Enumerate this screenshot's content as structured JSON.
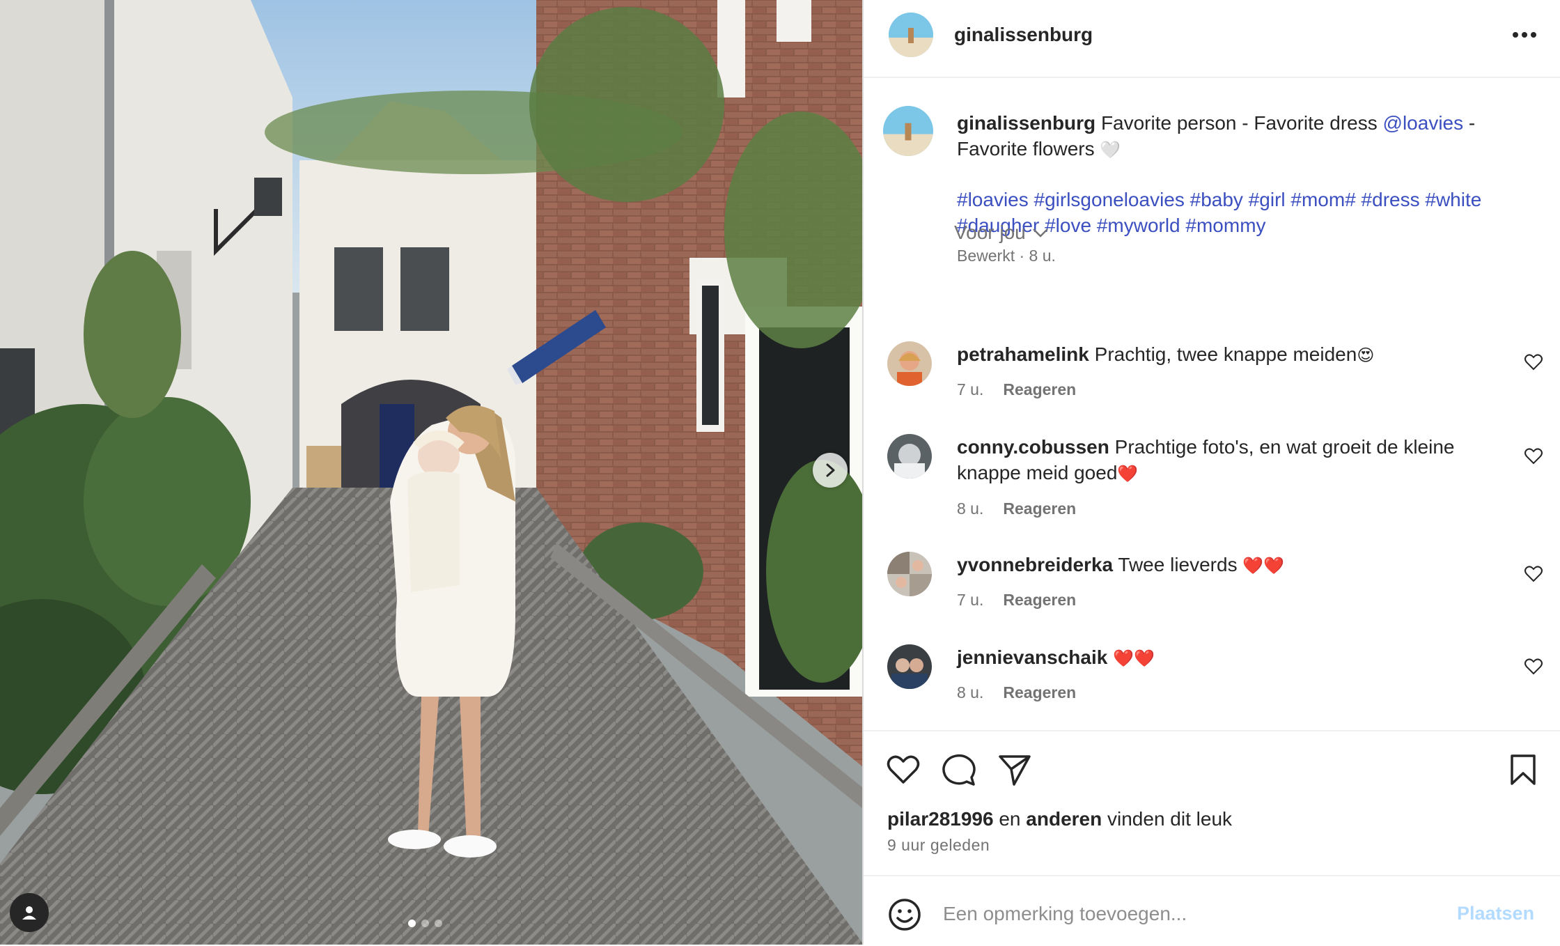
{
  "post": {
    "username": "ginalissenburg",
    "caption_text": "Favorite person - Favorite dress",
    "caption_mention": "@loavies",
    "caption_rest": "- Favorite flowers",
    "caption_emoji": "🤍",
    "hashtags_line1": "#loavies #girlsgoneloavies #baby #girl #mom# #dress #white",
    "hashtags_line2": "#daugher #love #myworld #mommy",
    "meta": "Bewerkt · 8 u."
  },
  "sort_label": "Voor jou",
  "reply_label": "Reageren",
  "comments": [
    {
      "user": "petrahamelink",
      "text": "Prachtig, twee knappe meiden",
      "emoji": "😍",
      "time": "7 u."
    },
    {
      "user": "conny.cobussen",
      "text": "Prachtige foto's, en wat groeit de kleine knappe meid goed",
      "emoji": "❤️",
      "time": "8 u."
    },
    {
      "user": "yvonnebreiderka",
      "text": "Twee lieverds",
      "emoji": "❤️❤️",
      "time": "7 u."
    },
    {
      "user": "jennievanschaik",
      "text": "",
      "emoji": "❤️❤️",
      "time": "8 u."
    }
  ],
  "likes": {
    "user": "pilar281996",
    "connector": "en",
    "others": "anderen",
    "suffix": "vinden dit leuk",
    "time_ago": "9 uur geleden"
  },
  "composer": {
    "placeholder": "Een opmerking toevoegen...",
    "post_label": "Plaatsen"
  },
  "carousel": {
    "total": 3,
    "active": 1
  },
  "colors": {
    "link": "#3b4fc0",
    "muted": "#737373",
    "post_disabled": "#b3dbff"
  },
  "icons": [
    "more-icon",
    "heart-icon",
    "comment-icon",
    "share-icon",
    "bookmark-icon",
    "emoji-icon",
    "chevron-right-icon",
    "person-tag-icon",
    "chevron-down-icon"
  ]
}
